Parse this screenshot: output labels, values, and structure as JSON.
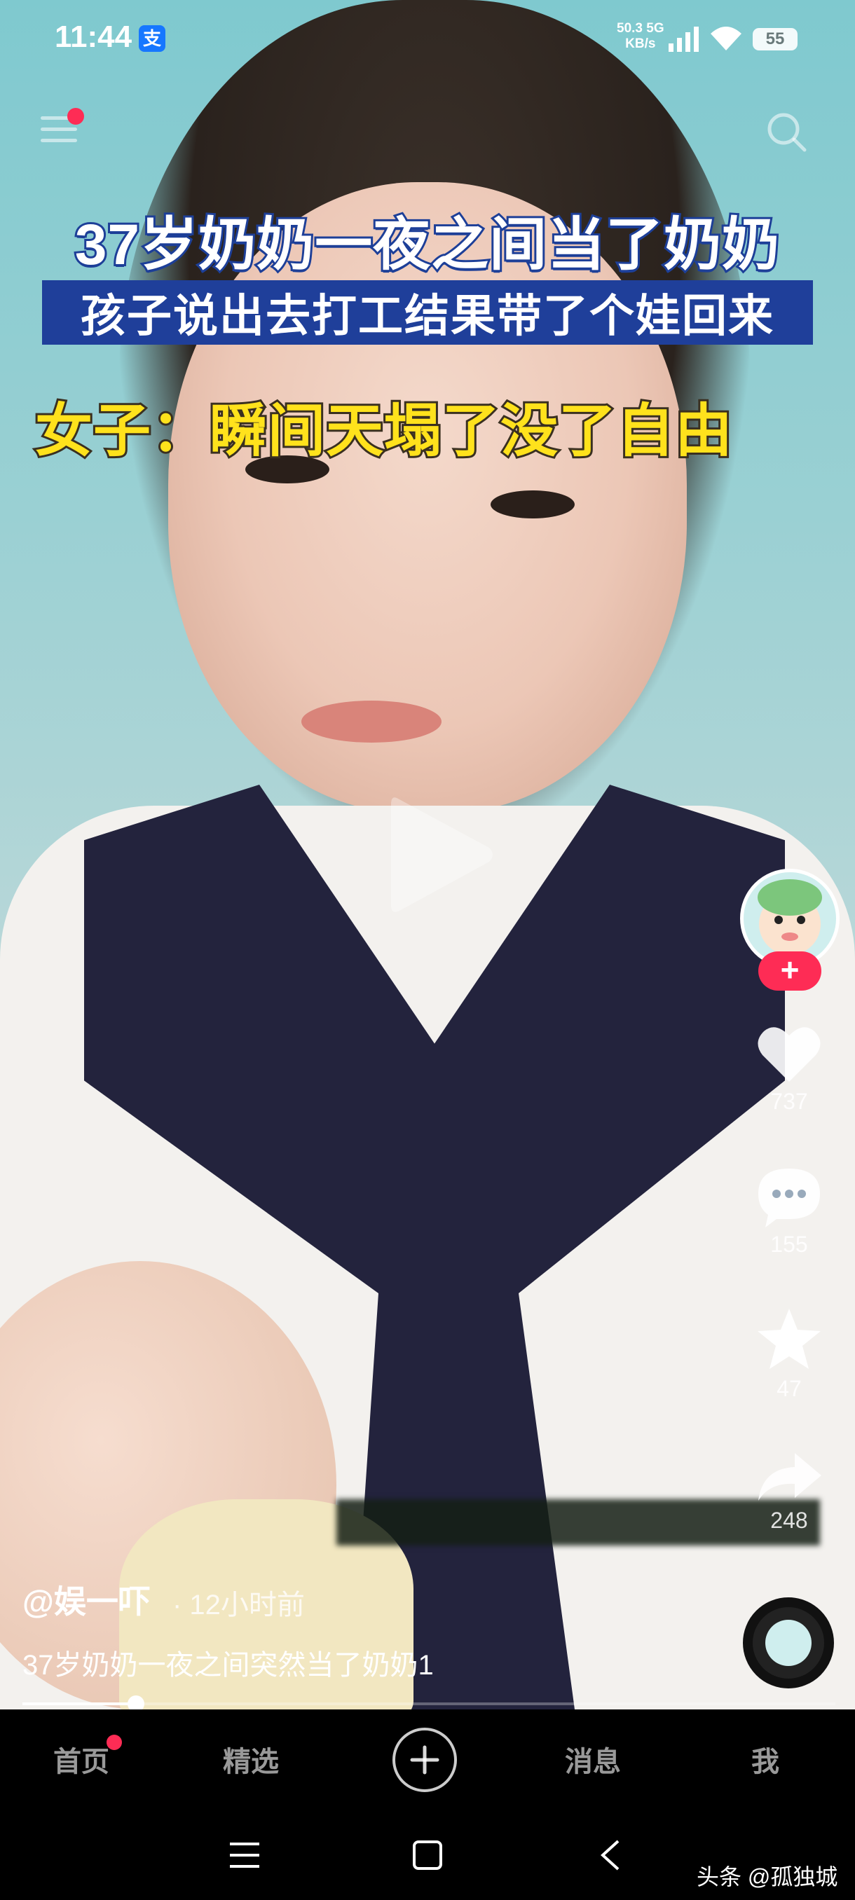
{
  "status_bar": {
    "time": "11:44",
    "alipay_glyph": "支",
    "net_speed_value": "50.3 5G",
    "net_speed_unit": "KB/s",
    "battery": "55"
  },
  "video": {
    "caption_line1": "37岁奶奶一夜之间当了奶奶",
    "caption_line2": "孩子说出去打工结果带了个娃回来",
    "caption_line3": "女子：瞬间天塌了没了自由",
    "progress_fraction": 0.14
  },
  "post": {
    "author": "@娱一吓",
    "time_ago": "· 12小时前",
    "description": "37岁奶奶一夜之间突然当了奶奶1"
  },
  "rail": {
    "follow_label": "+",
    "likes": "737",
    "comments": "155",
    "favorites": "47",
    "shares": "248"
  },
  "tabbar": {
    "home": "首页",
    "featured": "精选",
    "create": "+",
    "messages": "消息",
    "me": "我"
  },
  "watermark": "头条 @孤独城",
  "colors": {
    "accent": "#fe2c55",
    "caption_blue": "#1f3f9a",
    "caption_yellow": "#ffe21c"
  }
}
